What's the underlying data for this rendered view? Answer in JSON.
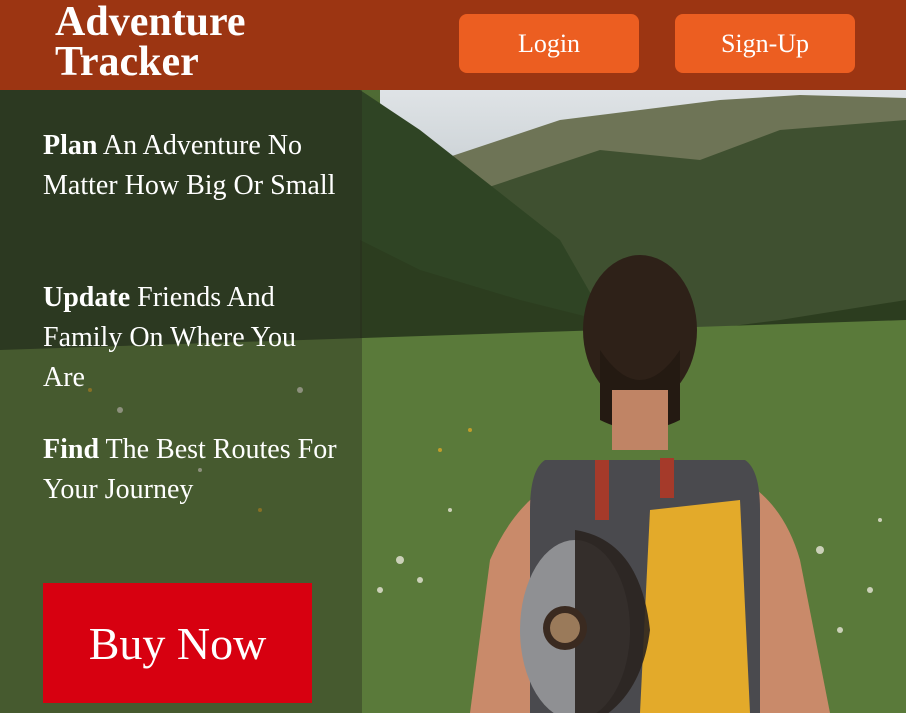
{
  "header": {
    "logo_line1": "Adventure",
    "logo_line2": "Tracker",
    "login_label": "Login",
    "signup_label": "Sign-Up"
  },
  "features": [
    {
      "bold": "Plan",
      "rest": " An Adventure No Matter How Big Or Small"
    },
    {
      "bold": "Update",
      "rest": " Friends And Family On Where You Are"
    },
    {
      "bold": "Find",
      "rest": " The Best Routes For Your Journey"
    }
  ],
  "cta": {
    "buy_label": "Buy Now"
  },
  "colors": {
    "header_bg": "#9c3512",
    "nav_button": "#ec5e21",
    "buy_button": "#d70010"
  }
}
